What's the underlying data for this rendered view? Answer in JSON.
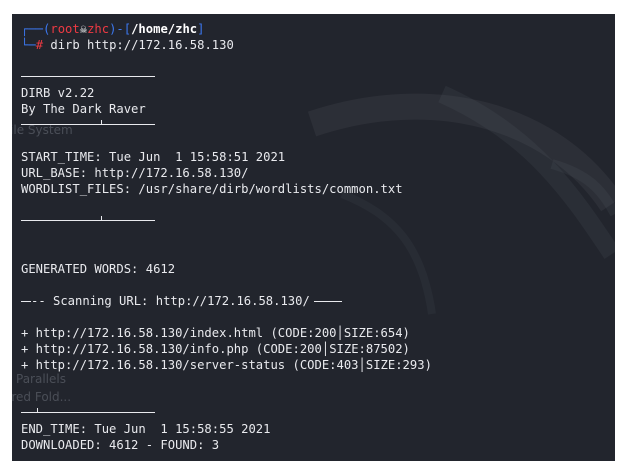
{
  "prompt": {
    "user": "root",
    "skull_glyph": "☠",
    "host": "zhc",
    "cwd": "/home/zhc",
    "symbol": "#",
    "command": "dirb http://172.16.58.130"
  },
  "banner": {
    "version": "DIRB v2.22",
    "author": "By The Dark Raver"
  },
  "config": {
    "start_time": "START_TIME: Tue Jun  1 15:58:51 2021",
    "url_base": "URL_BASE: http://172.16.58.130/",
    "wordlist": "WORDLIST_FILES: /usr/share/dirb/wordlists/common.txt"
  },
  "generated": "GENERATED WORDS: 4612",
  "scanning": "-- Scanning URL: http://172.16.58.130/",
  "results": [
    {
      "url": "+ http://172.16.58.130/index.html (CODE:200",
      "size": "SIZE:654)"
    },
    {
      "url": "+ http://172.16.58.130/info.php (CODE:200",
      "size": "SIZE:87502)"
    },
    {
      "url": "+ http://172.16.58.130/server-status (CODE:403",
      "size": "SIZE:293)"
    }
  ],
  "end": {
    "end_time": "END_TIME: Tue Jun  1 15:58:55 2021",
    "downloaded": "DOWNLOADED: 4612 - FOUND: 3"
  },
  "background_labels": {
    "file_system": "File System",
    "parallels": "Parallels",
    "shared_folders": "ared Fold..."
  },
  "colors": {
    "background": "#22252d",
    "text": "#e9eaee",
    "prompt_blue": "#3c78f0",
    "prompt_red": "#ee3a43"
  }
}
